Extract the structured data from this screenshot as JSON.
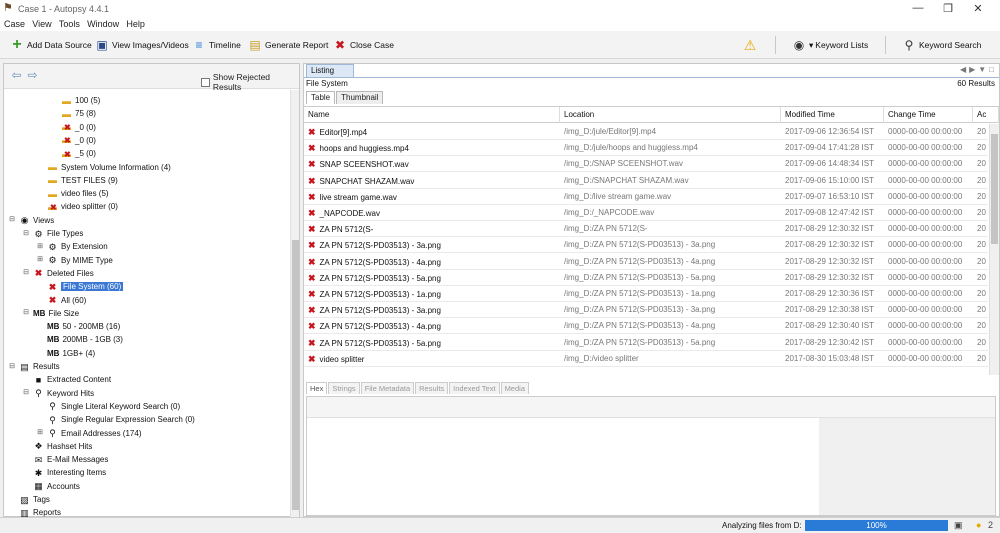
{
  "window": {
    "title": "Case 1 - Autopsy 4.4.1"
  },
  "menu": [
    "Case",
    "View",
    "Tools",
    "Window",
    "Help"
  ],
  "toolbar": {
    "add_data_source": "Add Data Source",
    "view_images": "View Images/Videos",
    "timeline": "Timeline",
    "generate_report": "Generate Report",
    "close_case": "Close Case",
    "keyword_lists": "Keyword Lists",
    "keyword_search": "Keyword Search"
  },
  "left": {
    "show_rejected": "Show Rejected Results",
    "tree": [
      {
        "label": "100 (5)",
        "indent": 3,
        "icon": "folder",
        "toggle": ""
      },
      {
        "label": "75 (8)",
        "indent": 3,
        "icon": "folder",
        "toggle": ""
      },
      {
        "label": "_0 (0)",
        "indent": 3,
        "icon": "folder-x",
        "toggle": ""
      },
      {
        "label": "_0 (0)",
        "indent": 3,
        "icon": "folder-x",
        "toggle": ""
      },
      {
        "label": "_5 (0)",
        "indent": 3,
        "icon": "folder-x",
        "toggle": ""
      },
      {
        "label": "System Volume Information (4)",
        "indent": 2,
        "icon": "folder",
        "toggle": ""
      },
      {
        "label": "TEST FILES (9)",
        "indent": 2,
        "icon": "folder",
        "toggle": ""
      },
      {
        "label": "video files (5)",
        "indent": 2,
        "icon": "folder",
        "toggle": ""
      },
      {
        "label": "video splitter (0)",
        "indent": 2,
        "icon": "folder-x",
        "toggle": ""
      },
      {
        "label": "Views",
        "indent": 0,
        "icon": "eye",
        "toggle": "−"
      },
      {
        "label": "File Types",
        "indent": 1,
        "icon": "gear",
        "toggle": "−"
      },
      {
        "label": "By Extension",
        "indent": 2,
        "icon": "gear",
        "toggle": "+"
      },
      {
        "label": "By MIME Type",
        "indent": 2,
        "icon": "gear",
        "toggle": "+"
      },
      {
        "label": "Deleted Files",
        "indent": 1,
        "icon": "x",
        "toggle": "−"
      },
      {
        "label": "File System (60)",
        "indent": 2,
        "icon": "x",
        "toggle": "",
        "selected": true
      },
      {
        "label": "All (60)",
        "indent": 2,
        "icon": "x",
        "toggle": ""
      },
      {
        "label": "File Size",
        "indent": 1,
        "icon": "MB",
        "toggle": "−"
      },
      {
        "label": "50 - 200MB (16)",
        "indent": 2,
        "icon": "MB",
        "toggle": ""
      },
      {
        "label": "200MB - 1GB (3)",
        "indent": 2,
        "icon": "MB",
        "toggle": ""
      },
      {
        "label": "1GB+ (4)",
        "indent": 2,
        "icon": "MB",
        "toggle": ""
      },
      {
        "label": "Results",
        "indent": 0,
        "icon": "results",
        "toggle": "−"
      },
      {
        "label": "Extracted Content",
        "indent": 1,
        "icon": "extract",
        "toggle": ""
      },
      {
        "label": "Keyword Hits",
        "indent": 1,
        "icon": "search",
        "toggle": "−"
      },
      {
        "label": "Single Literal Keyword Search (0)",
        "indent": 2,
        "icon": "search",
        "toggle": ""
      },
      {
        "label": "Single Regular Expression Search (0)",
        "indent": 2,
        "icon": "search",
        "toggle": ""
      },
      {
        "label": "Email Addresses (174)",
        "indent": 2,
        "icon": "search",
        "toggle": "+"
      },
      {
        "label": "Hashset Hits",
        "indent": 1,
        "icon": "hash",
        "toggle": ""
      },
      {
        "label": "E-Mail Messages",
        "indent": 1,
        "icon": "mail",
        "toggle": ""
      },
      {
        "label": "Interesting Items",
        "indent": 1,
        "icon": "star",
        "toggle": ""
      },
      {
        "label": "Accounts",
        "indent": 1,
        "icon": "accounts",
        "toggle": ""
      },
      {
        "label": "Tags",
        "indent": 0,
        "icon": "tags",
        "toggle": ""
      },
      {
        "label": "Reports",
        "indent": 0,
        "icon": "reports",
        "toggle": ""
      }
    ]
  },
  "right": {
    "listing_tab": "Listing",
    "file_system_label": "File System",
    "results_count": "60 Results",
    "subtabs": [
      "Table",
      "Thumbnail"
    ],
    "columns": [
      "Name",
      "Location",
      "Modified Time",
      "Change Time",
      "Ac"
    ],
    "rows": [
      {
        "name": "Editor[9].mp4",
        "location": "/img_D:/jule/Editor[9].mp4",
        "modified": "2017-09-06 12:36:54 IST",
        "change": "0000-00-00 00:00:00",
        "ac": "20"
      },
      {
        "name": "hoops and huggiess.mp4",
        "location": "/img_D:/jule/hoops and huggiess.mp4",
        "modified": "2017-09-04 17:41:28 IST",
        "change": "0000-00-00 00:00:00",
        "ac": "20"
      },
      {
        "name": "SNAP SCEENSHOT.wav",
        "location": "/img_D:/SNAP SCEENSHOT.wav",
        "modified": "2017-09-06 14:48:34 IST",
        "change": "0000-00-00 00:00:00",
        "ac": "20"
      },
      {
        "name": "SNAPCHAT SHAZAM.wav",
        "location": "/img_D:/SNAPCHAT SHAZAM.wav",
        "modified": "2017-09-06 15:10:00 IST",
        "change": "0000-00-00 00:00:00",
        "ac": "20"
      },
      {
        "name": "live stream game.wav",
        "location": "/img_D:/live stream game.wav",
        "modified": "2017-09-07 16:53:10 IST",
        "change": "0000-00-00 00:00:00",
        "ac": "20"
      },
      {
        "name": "_NAPCODE.wav",
        "location": "/img_D:/_NAPCODE.wav",
        "modified": "2017-09-08 12:47:42 IST",
        "change": "0000-00-00 00:00:00",
        "ac": "20"
      },
      {
        "name": "ZA PN 5712(S-",
        "location": "/img_D:/ZA PN 5712(S-",
        "modified": "2017-08-29 12:30:32 IST",
        "change": "0000-00-00 00:00:00",
        "ac": "20"
      },
      {
        "name": "ZA PN 5712(S-PD03513) - 3a.png",
        "location": "/img_D:/ZA PN 5712(S-PD03513) - 3a.png",
        "modified": "2017-08-29 12:30:32 IST",
        "change": "0000-00-00 00:00:00",
        "ac": "20"
      },
      {
        "name": "ZA PN 5712(S-PD03513) - 4a.png",
        "location": "/img_D:/ZA PN 5712(S-PD03513) - 4a.png",
        "modified": "2017-08-29 12:30:32 IST",
        "change": "0000-00-00 00:00:00",
        "ac": "20"
      },
      {
        "name": "ZA PN 5712(S-PD03513) - 5a.png",
        "location": "/img_D:/ZA PN 5712(S-PD03513) - 5a.png",
        "modified": "2017-08-29 12:30:32 IST",
        "change": "0000-00-00 00:00:00",
        "ac": "20"
      },
      {
        "name": "ZA PN 5712(S-PD03513) - 1a.png",
        "location": "/img_D:/ZA PN 5712(S-PD03513) - 1a.png",
        "modified": "2017-08-29 12:30:36 IST",
        "change": "0000-00-00 00:00:00",
        "ac": "20"
      },
      {
        "name": "ZA PN 5712(S-PD03513) - 3a.png",
        "location": "/img_D:/ZA PN 5712(S-PD03513) - 3a.png",
        "modified": "2017-08-29 12:30:38 IST",
        "change": "0000-00-00 00:00:00",
        "ac": "20"
      },
      {
        "name": "ZA PN 5712(S-PD03513) - 4a.png",
        "location": "/img_D:/ZA PN 5712(S-PD03513) - 4a.png",
        "modified": "2017-08-29 12:30:40 IST",
        "change": "0000-00-00 00:00:00",
        "ac": "20"
      },
      {
        "name": "ZA PN 5712(S-PD03513) - 5a.png",
        "location": "/img_D:/ZA PN 5712(S-PD03513) - 5a.png",
        "modified": "2017-08-29 12:30:42 IST",
        "change": "0000-00-00 00:00:00",
        "ac": "20"
      },
      {
        "name": "video splitter",
        "location": "/img_D:/video splitter",
        "modified": "2017-08-30 15:03:48 IST",
        "change": "0000-00-00 00:00:00",
        "ac": "20"
      }
    ],
    "lower_tabs": [
      "Hex",
      "Strings",
      "File Metadata",
      "Results",
      "Indexed Text",
      "Media"
    ]
  },
  "status": {
    "label": "Analyzing files from D:",
    "progress": "100%",
    "notifications": "2"
  },
  "colors": {
    "accent": "#3a78d4",
    "progress": "#2a7ad8",
    "deleted": "#c8161d",
    "folder": "#e0a820"
  }
}
